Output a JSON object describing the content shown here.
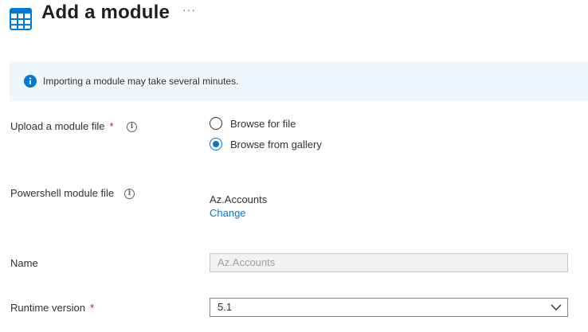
{
  "header": {
    "title": "Add a module",
    "more_label": "···",
    "icon": "module-grid-icon"
  },
  "info": {
    "icon": "info-icon",
    "text": "Importing a module may take several minutes."
  },
  "upload": {
    "label": "Upload a module file",
    "required_mark": "*",
    "options": [
      {
        "label": "Browse for file",
        "selected": false
      },
      {
        "label": "Browse from gallery",
        "selected": true
      }
    ]
  },
  "module_file": {
    "label": "Powershell module file",
    "value": "Az.Accounts",
    "change_label": "Change"
  },
  "name": {
    "label": "Name",
    "value": "Az.Accounts"
  },
  "runtime": {
    "label": "Runtime version",
    "required_mark": "*",
    "selected": "5.1"
  },
  "colors": {
    "accent": "#0078d4",
    "info_bg": "#eff6fc",
    "required": "#a4262c"
  }
}
